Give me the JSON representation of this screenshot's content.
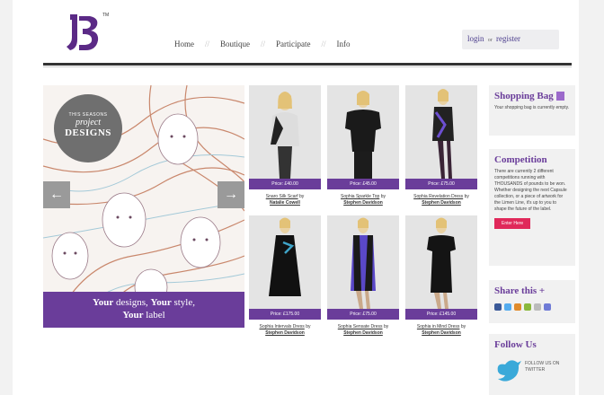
{
  "header": {
    "logo_text": "B",
    "trademark": "TM",
    "nav": [
      "Home",
      "Boutique",
      "Participate",
      "Info"
    ],
    "login": {
      "login_label": "login",
      "or": "or",
      "register_label": "register"
    }
  },
  "hero": {
    "badge_top": "THIS SEASONS",
    "badge_mid": "project",
    "badge_bottom": "DESIGNS",
    "caption_line1_bold1": "Your",
    "caption_line1_text1": " designs, ",
    "caption_line1_bold2": "Your",
    "caption_line1_text2": " style,",
    "caption_line2_bold": "Your",
    "caption_line2_text": " label",
    "prev_arrow": "←",
    "next_arrow": "→"
  },
  "products": [
    {
      "price": "Price: £40.00",
      "name": "Snaro Silk Scarf",
      "by": "by",
      "designer": "Natalie Cowell"
    },
    {
      "price": "Price: £45.00",
      "name": "Sophia Sparkle Top",
      "by": "by",
      "designer": "Stephen Davidson"
    },
    {
      "price": "Price: £75.00",
      "name": "Sophia Revelation Dress",
      "by": "by",
      "designer": "Stephen Davidson"
    },
    {
      "price": "Price: £175.00",
      "name": "Sophia Intervals Dress",
      "by": "by",
      "designer": "Stephen Davidson"
    },
    {
      "price": "Price: £75.00",
      "name": "Sophia Sensate Dress",
      "by": "by",
      "designer": "Stephen Davidson"
    },
    {
      "price": "Price: £145.00",
      "name": "Sophia in Mind Dress",
      "by": "by",
      "designer": "Stephen Davidson"
    }
  ],
  "sidebar": {
    "bag_title": "Shopping Bag",
    "bag_text": "Your shopping bag is currently empty.",
    "competition_title": "Competition",
    "competition_text": "There are currently 2 different competitions running with THOUSANDS of pounds to be won. Whether designing the next Capsule collection, or a piece of artwork for the Limen Line, it's up to you to shape the future of the label.",
    "enter_label": "Enter Here",
    "share_title": "Share this +",
    "follow_title": "Follow Us",
    "twitter_label": "FOLLOW US ON TWITTER"
  },
  "colors": {
    "brand_purple": "#6a3d9a",
    "accent_pink": "#e0285a"
  }
}
